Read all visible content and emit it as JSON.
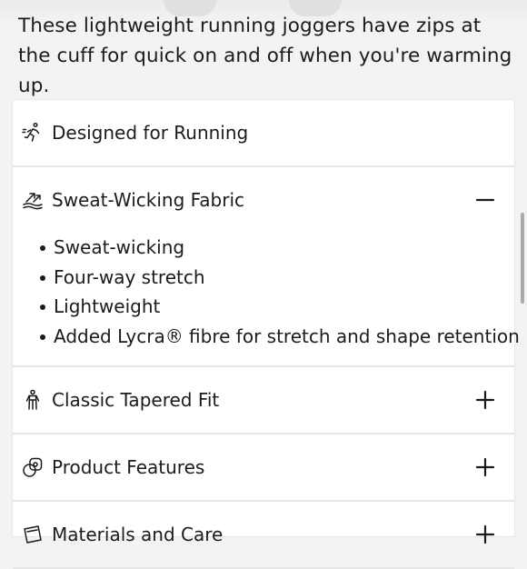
{
  "product": {
    "description": "These lightweight running joggers have zips at the cuff for quick on and off when you're warming up."
  },
  "accordion": {
    "items": [
      {
        "title": "Designed for Running",
        "icon": "runner-icon",
        "expanded": false,
        "toggle": "none"
      },
      {
        "title": "Sweat-Wicking Fabric",
        "icon": "sweat-wicking-icon",
        "expanded": true,
        "toggle": "minus-icon",
        "bullets": [
          "Sweat-wicking",
          "Four-way stretch",
          "Lightweight",
          "Added Lycra® fibre for stretch and shape retention"
        ]
      },
      {
        "title": "Classic Tapered Fit",
        "icon": "tapered-fit-icon",
        "expanded": false,
        "toggle": "plus-icon"
      },
      {
        "title": "Product Features",
        "icon": "product-features-icon",
        "expanded": false,
        "toggle": "plus-icon"
      },
      {
        "title": "Materials and Care",
        "icon": "materials-icon",
        "expanded": false,
        "toggle": "plus-icon"
      }
    ]
  },
  "colors": {
    "page_background": "#f3f3f4",
    "card_background": "#ffffff",
    "text": "#1b1b1b",
    "divider": "#e6e6e8",
    "scrollbar": "#a9a9ad"
  }
}
